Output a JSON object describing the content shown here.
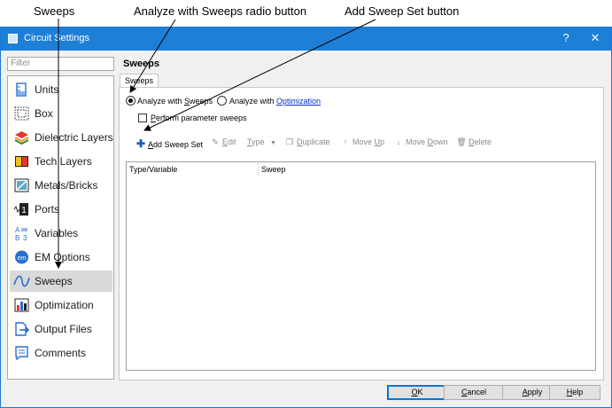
{
  "callouts": {
    "sweeps": "Sweeps",
    "analyze": "Analyze with Sweeps radio button",
    "add_sweep": "Add Sweep Set button"
  },
  "window": {
    "title": "Circuit Settings",
    "help_glyph": "?",
    "close_glyph": "✕"
  },
  "sidebar": {
    "filter_placeholder": "Filter",
    "items": [
      {
        "label": "Units",
        "icon": "units-icon"
      },
      {
        "label": "Box",
        "icon": "box-icon"
      },
      {
        "label": "Dielectric Layers",
        "icon": "dielectric-layers-icon"
      },
      {
        "label": "Tech Layers",
        "icon": "tech-layers-icon"
      },
      {
        "label": "Metals/Bricks",
        "icon": "metals-bricks-icon"
      },
      {
        "label": "Ports",
        "icon": "ports-icon"
      },
      {
        "label": "Variables",
        "icon": "variables-icon"
      },
      {
        "label": "EM Options",
        "icon": "em-options-icon"
      },
      {
        "label": "Sweeps",
        "icon": "sweeps-icon",
        "selected": true
      },
      {
        "label": "Optimization",
        "icon": "optimization-icon"
      },
      {
        "label": "Output Files",
        "icon": "output-files-icon"
      },
      {
        "label": "Comments",
        "icon": "comments-icon"
      }
    ]
  },
  "main": {
    "section_title": "Sweeps",
    "tab_label": "Sweeps",
    "radio_sweeps_pre": "Analyze with ",
    "radio_sweeps_ul": "S",
    "radio_sweeps_post": "weeps",
    "radio_opt_pre": "Analyze with ",
    "radio_opt_link": "Optimization",
    "checkbox_ul": "P",
    "checkbox_post": "erform parameter sweeps",
    "toolbar": {
      "add_ul": "A",
      "add_post": "dd Sweep Set",
      "edit_ul": "E",
      "edit_post": "dit",
      "type_ul": "T",
      "type_post": "ype",
      "duplicate_ul": "D",
      "duplicate_post": "uplicate",
      "moveup_pre": "Move ",
      "moveup_ul": "U",
      "moveup_post": "p",
      "movedown_pre": "Move ",
      "movedown_ul": "D",
      "movedown_post": "own",
      "delete_ul": "D",
      "delete_post": "elete"
    },
    "table": {
      "columns": [
        "Type/Variable",
        "Sweep"
      ]
    }
  },
  "footer": {
    "ok_ul": "O",
    "ok_post": "K",
    "cancel_pre": "",
    "cancel_ul": "C",
    "cancel_post": "ancel",
    "apply_ul": "A",
    "apply_post": "pply",
    "help_ul": "H",
    "help_post": "elp"
  },
  "colors": {
    "titlebar": "#1e7fd6",
    "accent": "#0078d7",
    "selected_row": "#d9d9d9"
  }
}
